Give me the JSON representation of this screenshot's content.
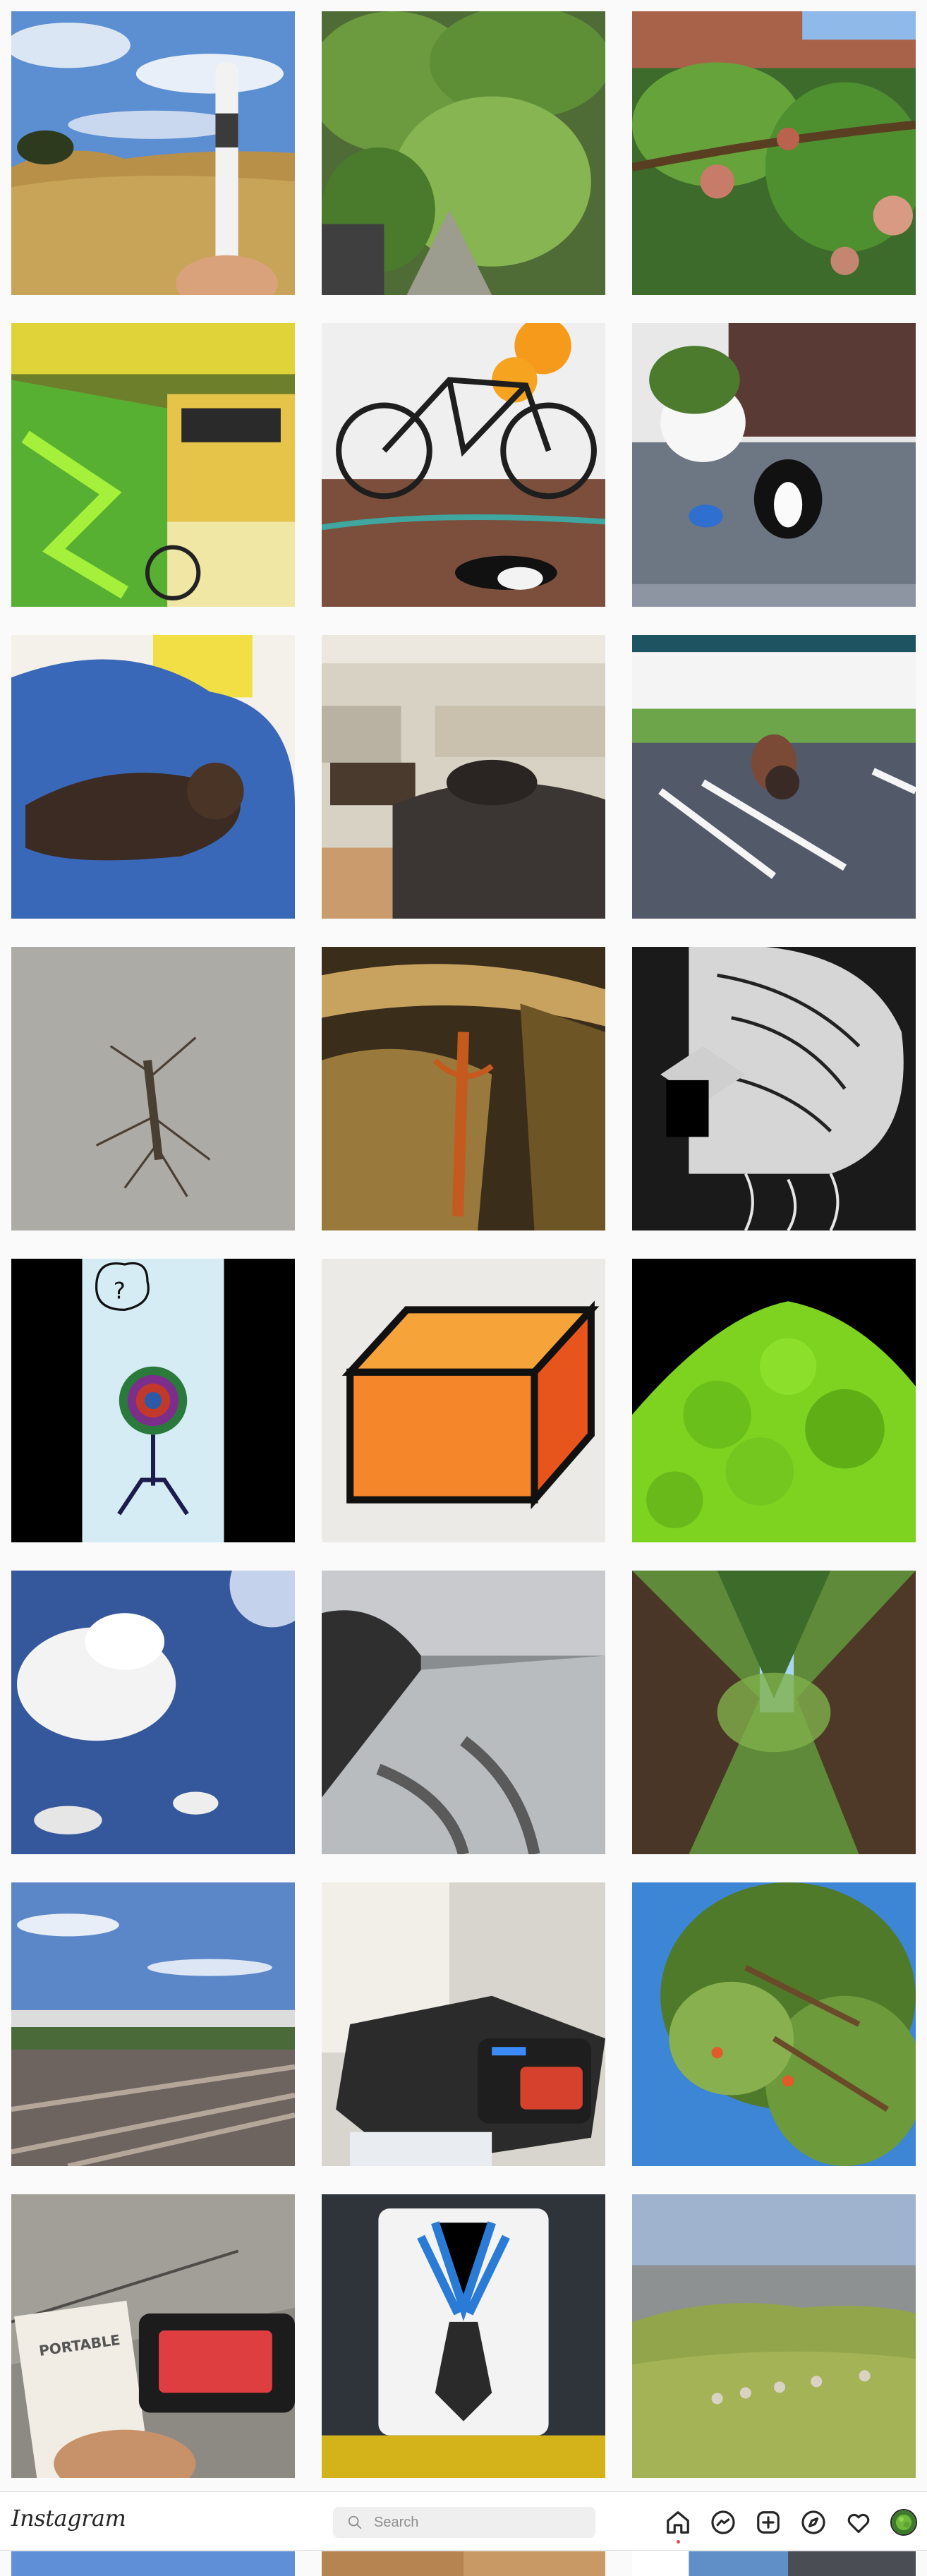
{
  "app": {
    "name": "Instagram"
  },
  "header": {
    "logo_text": "Instagram",
    "search": {
      "placeholder": "Search",
      "value": ""
    },
    "nav": [
      {
        "name": "home-icon",
        "active": true
      },
      {
        "name": "messenger-icon"
      },
      {
        "name": "new-post-icon"
      },
      {
        "name": "explore-icon"
      },
      {
        "name": "activity-heart-icon"
      },
      {
        "name": "profile-avatar"
      }
    ],
    "notification_dot_color": "#ed4956"
  },
  "grid": {
    "posts": [
      {
        "subject": "vape pen held up over a dry grassy hillside"
      },
      {
        "subject": "leafy plants in garden planters"
      },
      {
        "subject": "apple tree branch with fruit"
      },
      {
        "subject": "graffiti covered wall with bicycle"
      },
      {
        "subject": "bicycle and orange balloons, cat lying on patio"
      },
      {
        "subject": "black and white cat by front door with potted plant"
      },
      {
        "subject": "tortoiseshell cat on blue tarp"
      },
      {
        "subject": "cat in living room chair"
      },
      {
        "subject": "wild turkey in parking lot"
      },
      {
        "subject": "crane fly on concrete wall"
      },
      {
        "subject": "lizard among tree roots"
      },
      {
        "subject": "black and white abstract drawing of a face"
      },
      {
        "subject": "drawing of a creature with question mark bubble"
      },
      {
        "subject": "drawing of an orange box"
      },
      {
        "subject": "romanesco broccoli on black background"
      },
      {
        "subject": "clouds in blue sky with sun"
      },
      {
        "subject": "rocky coastline with footprints in sand"
      },
      {
        "subject": "redwood trees seen from below"
      },
      {
        "subject": "railroad tracks under blue sky"
      },
      {
        "subject": "black portable power station"
      },
      {
        "subject": "tree branches against blue sky"
      },
      {
        "subject": "portable power station box and red device"
      },
      {
        "subject": "sticker of figure with blue hair"
      },
      {
        "subject": "sheep grazing on green hill above city"
      }
    ],
    "partial_row": [
      {
        "subject": "blue sky"
      },
      {
        "subject": "sandy hillside"
      },
      {
        "subject": "building with blue sky"
      }
    ]
  }
}
